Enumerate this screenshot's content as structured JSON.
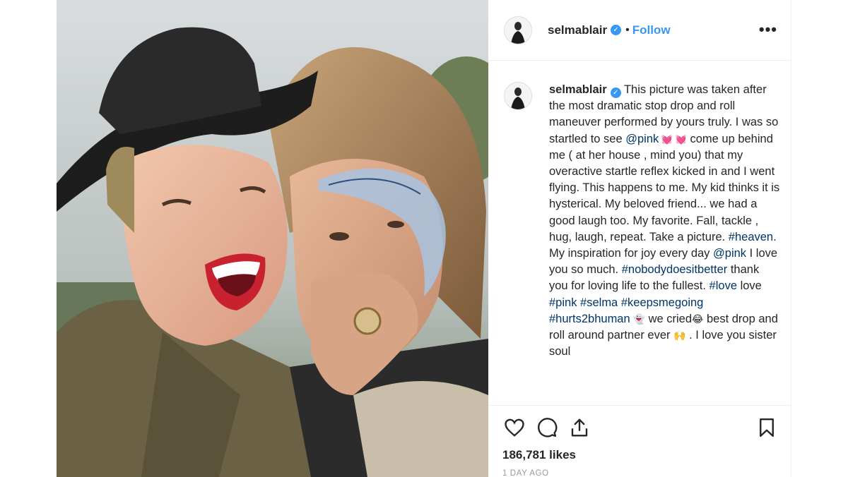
{
  "post": {
    "username": "selmablair",
    "follow_label": "Follow",
    "separator": "•",
    "more_label": "•••",
    "verified_mark": "✓",
    "caption_segments": [
      {
        "type": "text",
        "text": "This picture was taken after the most dramatic stop drop and roll maneuver performed by yours truly. I was so startled to see "
      },
      {
        "type": "link",
        "text": "@pink"
      },
      {
        "type": "heart",
        "text": " 💓 💓"
      },
      {
        "type": "text",
        "text": " come up behind me ( at her house , mind you) that my overactive startle reflex kicked in and I went flying. This happens to me. My kid thinks it is hysterical. My beloved friend... we had a good laugh too. My favorite. Fall, tackle , hug, laugh, repeat. Take a picture. "
      },
      {
        "type": "link",
        "text": "#heaven"
      },
      {
        "type": "text",
        "text": ". My inspiration for joy every day "
      },
      {
        "type": "link",
        "text": "@pink"
      },
      {
        "type": "text",
        "text": " I love you so much. "
      },
      {
        "type": "link",
        "text": "#nobodydoesitbetter"
      },
      {
        "type": "text",
        "text": " thank you for loving life to the fullest. "
      },
      {
        "type": "link",
        "text": "#love"
      },
      {
        "type": "text",
        "text": " love "
      },
      {
        "type": "link",
        "text": "#pink"
      },
      {
        "type": "text",
        "text": " "
      },
      {
        "type": "link",
        "text": "#selma"
      },
      {
        "type": "text",
        "text": " "
      },
      {
        "type": "link",
        "text": "#keepsmegoing"
      },
      {
        "type": "text",
        "text": " "
      },
      {
        "type": "link",
        "text": "#hurts2bhuman"
      },
      {
        "type": "emoji",
        "text": " 👻"
      },
      {
        "type": "text",
        "text": "  we cried"
      },
      {
        "type": "emoji",
        "text": "😂"
      },
      {
        "type": "text",
        "text": "  best drop and roll around partner ever "
      },
      {
        "type": "emoji",
        "text": "🙌"
      },
      {
        "type": "text",
        "text": " . I love you sister soul"
      }
    ],
    "likes": "186,781 likes",
    "timestamp": "1 DAY AGO"
  },
  "icons": {
    "like": "heart-icon",
    "comment": "comment-bubble-icon",
    "share": "share-upload-icon",
    "save": "bookmark-icon",
    "verified": "verified-badge-icon",
    "more": "more-options-icon"
  },
  "colors": {
    "link": "#003569",
    "follow": "#3897f0",
    "verified": "#3897f0",
    "text": "#262626",
    "muted": "#999999",
    "divider": "#efefef"
  }
}
